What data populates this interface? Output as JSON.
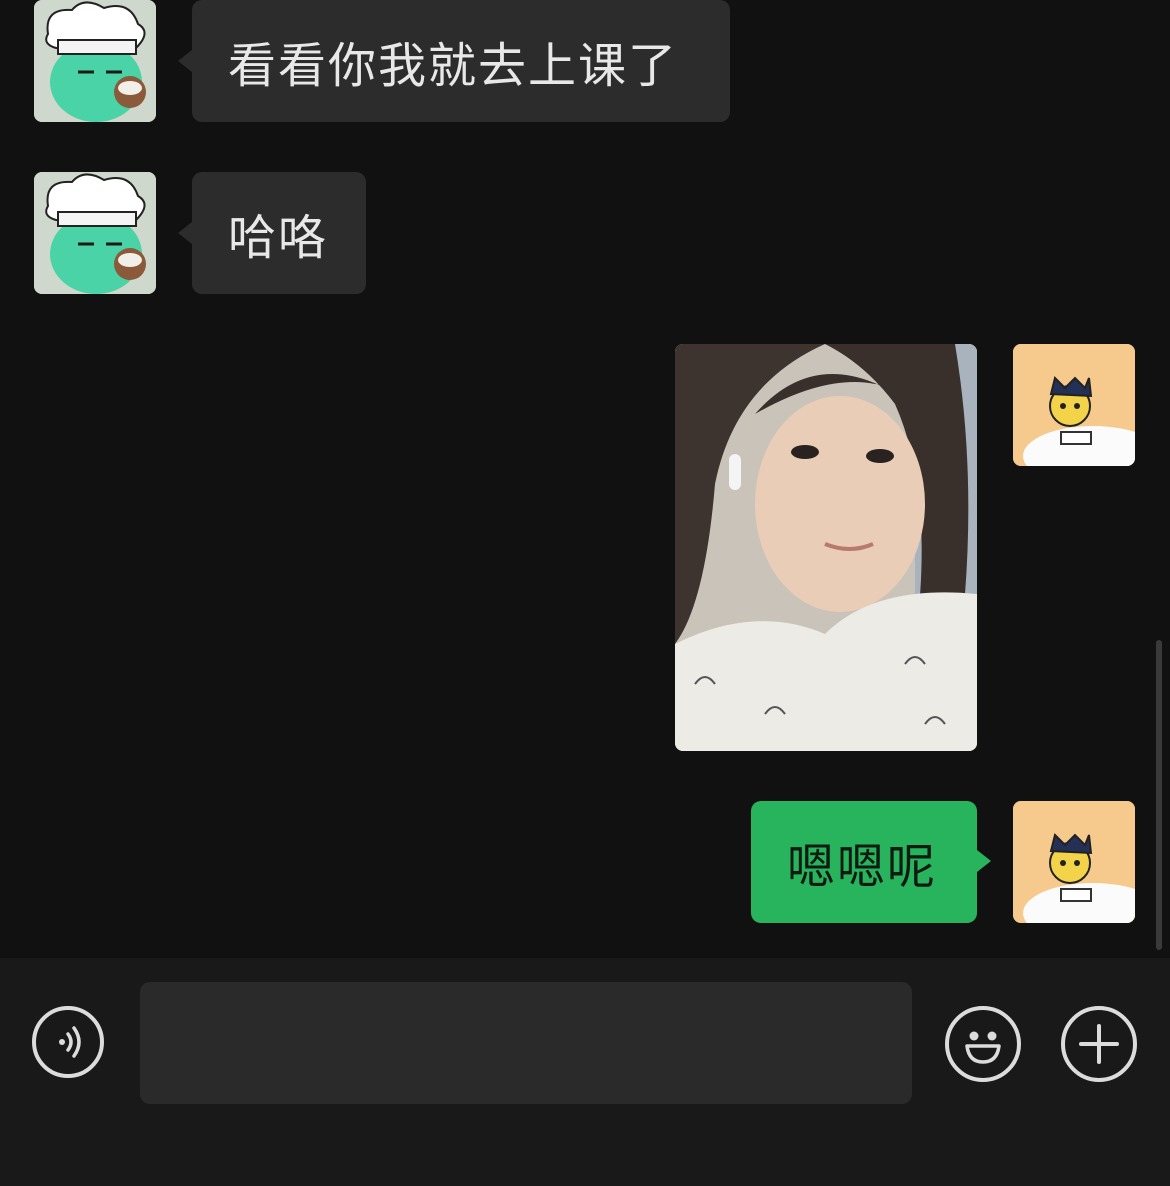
{
  "messages": [
    {
      "side": "left",
      "type": "text",
      "text": "看看你我就去上课了",
      "avatar_icon": "chef-hat-cartoon-icon"
    },
    {
      "side": "left",
      "type": "text",
      "text": "哈咯",
      "avatar_icon": "chef-hat-cartoon-icon"
    },
    {
      "side": "right",
      "type": "image",
      "avatar_icon": "yellow-mascot-icon"
    },
    {
      "side": "right",
      "type": "text",
      "text": "嗯嗯呢",
      "avatar_icon": "yellow-mascot-icon"
    }
  ],
  "input_bar": {
    "voice_icon": "voice-icon",
    "emoji_icon": "emoji-icon",
    "plus_icon": "plus-icon",
    "text_value": ""
  },
  "colors": {
    "background": "#111111",
    "bubble_received": "#2c2c2c",
    "bubble_sent": "#27b45c",
    "input_bar": "#191919"
  }
}
